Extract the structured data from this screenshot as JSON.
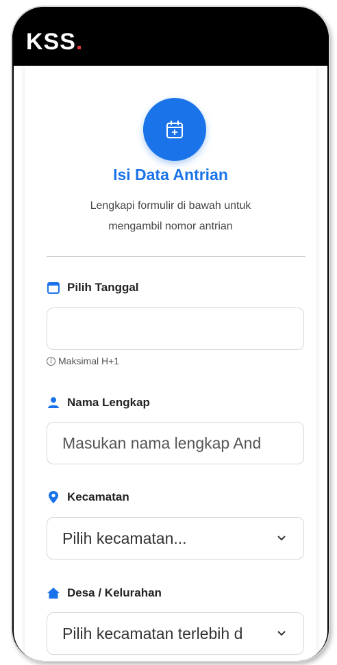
{
  "app": {
    "logo_text": "KSS",
    "logo_dot": "."
  },
  "header": {
    "title": "Isi Data Antrian",
    "subtitle": "Lengkapi formulir di bawah untuk mengambil nomor antrian"
  },
  "form": {
    "date": {
      "label": "Pilih Tanggal",
      "value": "",
      "hint": "Maksimal H+1"
    },
    "name": {
      "label": "Nama Lengkap",
      "placeholder": "Masukan nama lengkap And"
    },
    "kecamatan": {
      "label": "Kecamatan",
      "value": "Pilih kecamatan..."
    },
    "desa": {
      "label": "Desa / Kelurahan",
      "value": "Pilih kecamatan terlebih d"
    }
  },
  "colors": {
    "accent": "#1a73e8",
    "logo_dot": "#e53935"
  }
}
